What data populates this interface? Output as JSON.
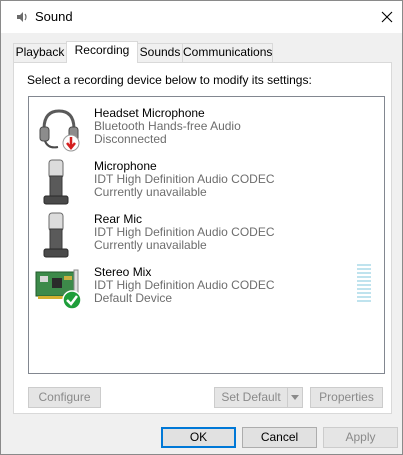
{
  "window": {
    "title": "Sound"
  },
  "tabs": [
    {
      "label": "Playback"
    },
    {
      "label": "Recording"
    },
    {
      "label": "Sounds"
    },
    {
      "label": "Communications"
    }
  ],
  "active_tab": "Recording",
  "instruction": "Select a recording device below to modify its settings:",
  "devices": [
    {
      "name": "Headset Microphone",
      "description": "Bluetooth Hands-free Audio",
      "status": "Disconnected",
      "icon": "headset-microphone-icon",
      "badge": "red-down-arrow"
    },
    {
      "name": "Microphone",
      "description": "IDT High Definition Audio CODEC",
      "status": "Currently unavailable",
      "icon": "microphone-icon"
    },
    {
      "name": "Rear Mic",
      "description": "IDT High Definition Audio CODEC",
      "status": "Currently unavailable",
      "icon": "microphone-icon"
    },
    {
      "name": "Stereo Mix",
      "description": "IDT High Definition Audio CODEC",
      "status": "Default Device",
      "icon": "sound-card-icon",
      "badge": "green-checkmark"
    }
  ],
  "buttons": {
    "configure": "Configure",
    "set_default": "Set Default",
    "properties": "Properties",
    "ok": "OK",
    "cancel": "Cancel",
    "apply": "Apply"
  },
  "colors": {
    "accent": "#0078d7",
    "badge_red": "#d42020",
    "badge_green": "#1e9e3a",
    "level_meter": "#bfe3ee"
  }
}
